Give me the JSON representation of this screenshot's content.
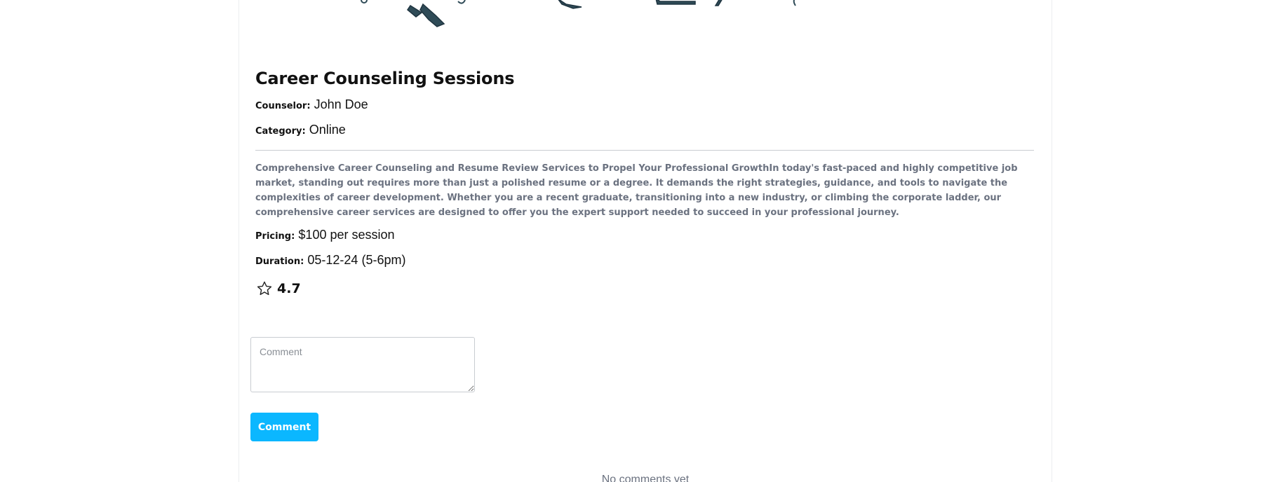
{
  "service": {
    "title": "Career Counseling Sessions",
    "counselor_label": "Counselor:",
    "counselor": "John Doe",
    "category_label": "Category:",
    "category": "Online",
    "description": "Comprehensive Career Counseling and Resume Review Services to Propel Your Professional GrowthIn today's fast-paced and highly competitive job market, standing out requires more than just a polished resume or a degree. It demands the right strategies, guidance, and tools to navigate the complexities of career development. Whether you are a recent graduate, transitioning into a new industry, or climbing the corporate ladder, our comprehensive career services are designed to offer you the expert support needed to succeed in your professional journey.",
    "pricing_label": "Pricing:",
    "pricing": "$100 per session",
    "duration_label": "Duration:",
    "duration": "05-12-24 (5-6pm)",
    "rating": "4.7",
    "rating_icon": "star-outline-icon"
  },
  "comments": {
    "placeholder": "Comment",
    "button_label": "Comment",
    "empty_text": "No comments yet"
  },
  "colors": {
    "accent": "#0bb7ff",
    "muted_text": "#6b7280",
    "illustration": "#2f4b57"
  }
}
